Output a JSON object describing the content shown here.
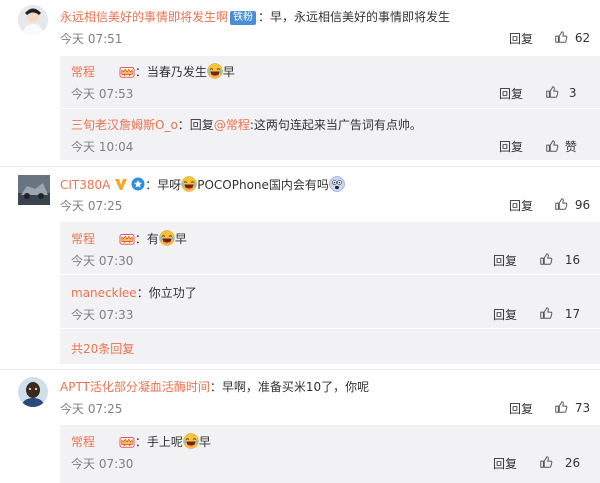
{
  "actions": {
    "reply": "回复",
    "like": "赞"
  },
  "comments": [
    {
      "user": "永远相信美好的事情即将发生啊",
      "badge": "铁粉",
      "text": "：早，永远相信美好的事情即将发生",
      "time": "今天 07:51",
      "likes": "62",
      "replies": [
        {
          "user": "常程",
          "text_before": "：当春乃发生",
          "text_after": "早",
          "time": "今天 07:53",
          "likes": "3"
        },
        {
          "user": "三旬老汉詹姆斯O_o",
          "text_before": "：回复",
          "mention": "@常程",
          "text_after": ":这两句连起来当广告词有点帅。",
          "time": "今天 10:04",
          "likes": "赞"
        }
      ]
    },
    {
      "user": "CIT380A",
      "text_before": "：早呀",
      "text_after": "POCOPhone国内会有吗",
      "time": "今天 07:25",
      "likes": "96",
      "replies": [
        {
          "user": "常程",
          "text_before": "：有",
          "text_after": "早",
          "time": "今天 07:30",
          "likes": "16"
        },
        {
          "user": "manecklee",
          "text": "：你立功了",
          "time": "今天 07:33",
          "likes": "17"
        }
      ],
      "more": "共20条回复"
    },
    {
      "user": "APTT活化部分凝血活酶时间",
      "text": "：早啊，准备买米10了，你呢",
      "time": "今天 07:25",
      "likes": "73",
      "replies": [
        {
          "user": "常程",
          "text_before": "：手上呢",
          "text_after": "早",
          "time": "今天 07:30",
          "likes": "26"
        }
      ]
    }
  ],
  "colors": {
    "name": "#eb7350",
    "subbg": "#f2f2f5",
    "time": "#808080"
  }
}
